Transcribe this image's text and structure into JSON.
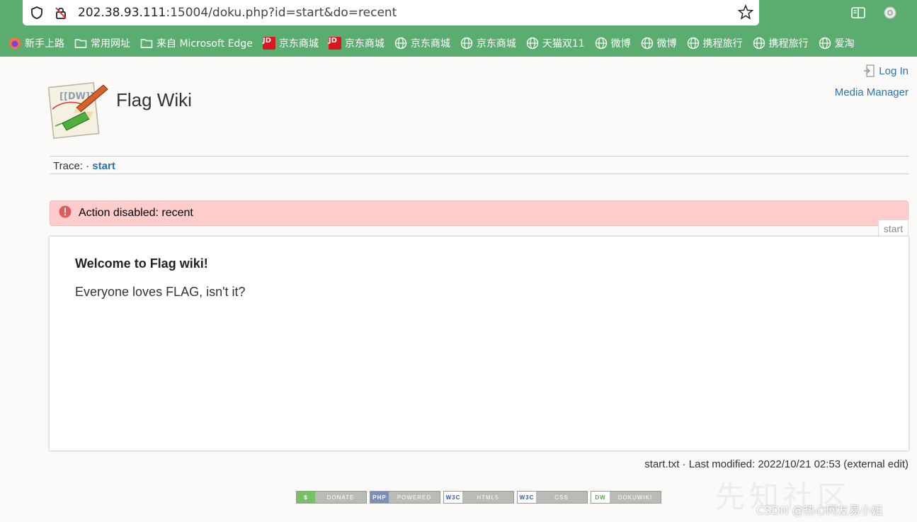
{
  "browser": {
    "url_host": "202.38.93.111",
    "url_rest": ":15004/doku.php?id=start&do=recent",
    "bookmarks": [
      {
        "label": "新手上路",
        "icon": "firefox-icon"
      },
      {
        "label": "常用网址",
        "icon": "folder-icon"
      },
      {
        "label": "来自 Microsoft Edge",
        "icon": "folder-icon"
      },
      {
        "label": "京东商城",
        "icon": "jd-icon"
      },
      {
        "label": "京东商城",
        "icon": "jd-icon"
      },
      {
        "label": "京东商城",
        "icon": "globe-icon"
      },
      {
        "label": "京东商城",
        "icon": "globe-icon"
      },
      {
        "label": "天猫双11",
        "icon": "globe-icon"
      },
      {
        "label": "微博",
        "icon": "globe-icon"
      },
      {
        "label": "微博",
        "icon": "globe-icon"
      },
      {
        "label": "携程旅行",
        "icon": "globe-icon"
      },
      {
        "label": "携程旅行",
        "icon": "globe-icon"
      },
      {
        "label": "爱淘",
        "icon": "globe-icon"
      }
    ],
    "jd_text": "JD"
  },
  "header": {
    "login": "Log In",
    "media_manager": "Media Manager",
    "site_title": "Flag Wiki"
  },
  "trace": {
    "label": "Trace:",
    "sep": "·",
    "link": "start"
  },
  "alert": {
    "message": "Action disabled: recent"
  },
  "page": {
    "tab": "start",
    "heading": "Welcome to Flag wiki!",
    "body": "Everyone loves FLAG, isn't it?"
  },
  "docinfo": "start.txt · Last modified: 2022/10/21 02:53 (external edit)",
  "badges": [
    {
      "left": "$",
      "right": "DONATE",
      "color": "#76c164"
    },
    {
      "left": "PHP",
      "right": "POWERED",
      "color": "#7b8fb8"
    },
    {
      "left": "W3C",
      "right": "HTML5",
      "color": "#b9bcb4"
    },
    {
      "left": "W3C",
      "right": "CSS",
      "color": "#b9bcb4"
    },
    {
      "left": "DW",
      "right": "DOKUWIKI",
      "color": "#b9bcb4"
    }
  ],
  "watermark": {
    "big": "先知社区",
    "small": "CSDN @热心网友易小姐"
  },
  "colors": {
    "chrome": "#5aad6f",
    "link": "#2b73b7",
    "alert_bg": "#ffcccc",
    "alert_icon": "#e05a5a"
  }
}
